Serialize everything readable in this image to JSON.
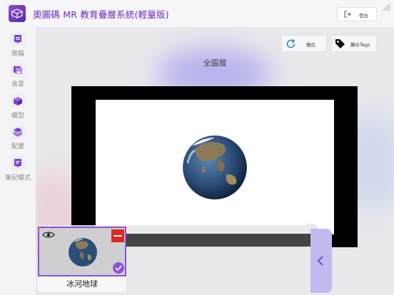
{
  "header": {
    "app_title": "奧圖碼 MR 教育疊層系統(輕量版)",
    "logout_label": "登出"
  },
  "sidebar": {
    "items": [
      {
        "label": "簡報",
        "icon": "presentation-icon"
      },
      {
        "label": "背景",
        "icon": "background-image-icon"
      },
      {
        "label": "模型",
        "icon": "cube-model-icon"
      },
      {
        "label": "配置",
        "icon": "layers-icon"
      },
      {
        "label": "筆記模式",
        "icon": "notes-icon"
      }
    ]
  },
  "toolbar": {
    "reset_label": "復位",
    "show_tags_label": "顯示Tags"
  },
  "scene": {
    "title": "全圖層"
  },
  "tray": {
    "cards": [
      {
        "caption": "冰河地球",
        "selected": true,
        "visible": true
      }
    ]
  },
  "colors": {
    "accent": "#6a2fc0",
    "selection": "#8a55d8",
    "remove": "#e0261b",
    "tray_tab": "#c3b8f0"
  }
}
